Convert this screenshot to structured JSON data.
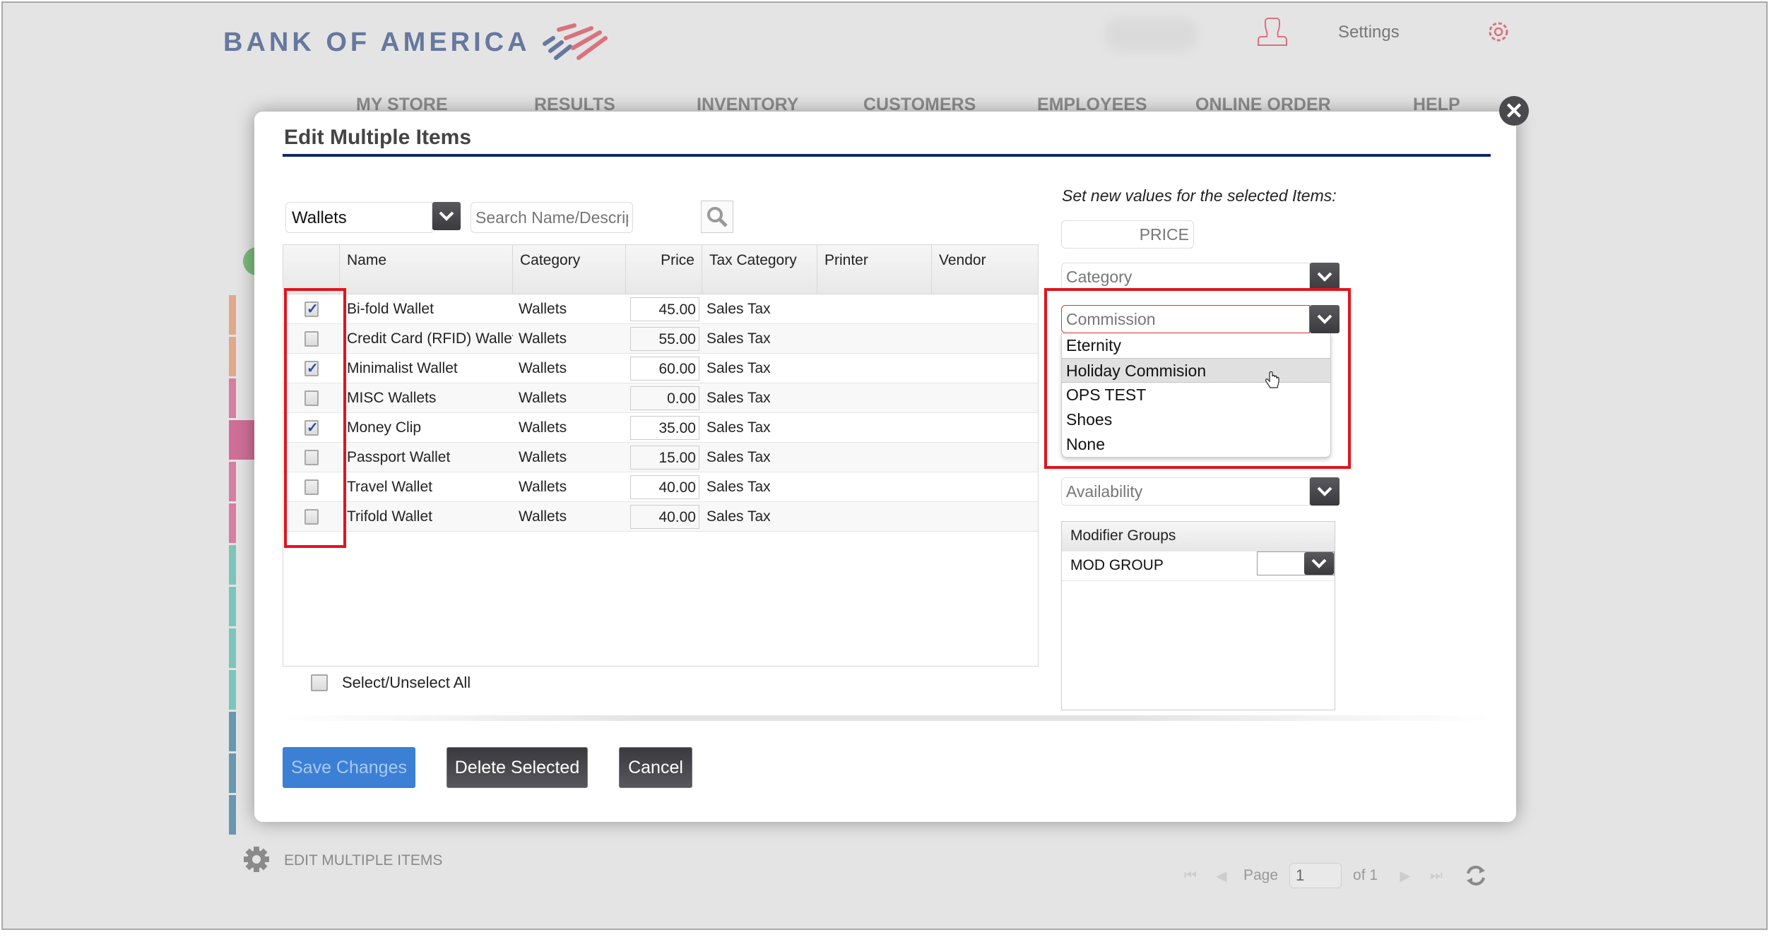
{
  "header": {
    "brand": "BANK OF AMERICA",
    "settings_label": "Settings",
    "brand_colors": {
      "blue": "#66789e",
      "red": "#d9727d"
    }
  },
  "nav": {
    "items": [
      "MY STORE",
      "RESULTS",
      "INVENTORY",
      "CUSTOMERS",
      "EMPLOYEES",
      "ONLINE ORDER",
      "HELP"
    ]
  },
  "background": {
    "stripe_colors": [
      "#e0a98c",
      "#e0a98c",
      "#d77ea2",
      "#cf6f97",
      "#d77ea2",
      "#d77ea2",
      "#7dc4bc",
      "#7dc4bc",
      "#7dc4bc",
      "#7dc4bc",
      "#6898b0",
      "#6898b0",
      "#6898b0"
    ],
    "footer_label": "EDIT MULTIPLE ITEMS",
    "pager": {
      "page_label": "Page",
      "page_value": "1",
      "of_label": "of 1"
    }
  },
  "modal": {
    "title": "Edit Multiple Items",
    "filter": {
      "selected": "Wallets",
      "search_placeholder": "Search Name/Description"
    },
    "table": {
      "columns": [
        "",
        "Name",
        "Category",
        "Price",
        "Tax Category",
        "Printer",
        "Vendor"
      ],
      "rows": [
        {
          "checked": true,
          "name": "Bi-fold Wallet",
          "category": "Wallets",
          "price": "45.00",
          "tax": "Sales Tax",
          "printer": "",
          "vendor": ""
        },
        {
          "checked": false,
          "name": "Credit Card (RFID) Wallet",
          "category": "Wallets",
          "price": "55.00",
          "tax": "Sales Tax",
          "printer": "",
          "vendor": ""
        },
        {
          "checked": true,
          "name": "Minimalist Wallet",
          "category": "Wallets",
          "price": "60.00",
          "tax": "Sales Tax",
          "printer": "",
          "vendor": ""
        },
        {
          "checked": false,
          "name": "MISC Wallets",
          "category": "Wallets",
          "price": "0.00",
          "tax": "Sales Tax",
          "printer": "",
          "vendor": ""
        },
        {
          "checked": true,
          "name": "Money Clip",
          "category": "Wallets",
          "price": "35.00",
          "tax": "Sales Tax",
          "printer": "",
          "vendor": ""
        },
        {
          "checked": false,
          "name": "Passport Wallet",
          "category": "Wallets",
          "price": "15.00",
          "tax": "Sales Tax",
          "printer": "",
          "vendor": ""
        },
        {
          "checked": false,
          "name": "Travel Wallet",
          "category": "Wallets",
          "price": "40.00",
          "tax": "Sales Tax",
          "printer": "",
          "vendor": ""
        },
        {
          "checked": false,
          "name": "Trifold Wallet",
          "category": "Wallets",
          "price": "40.00",
          "tax": "Sales Tax",
          "printer": "",
          "vendor": ""
        }
      ]
    },
    "select_all_label": "Select/Unselect All",
    "buttons": {
      "save": "Save Changes",
      "delete": "Delete Selected",
      "cancel": "Cancel"
    },
    "right_panel": {
      "instruction": "Set new values for the selected Items:",
      "price_placeholder": "PRICE",
      "category_placeholder": "Category",
      "commission_placeholder": "Commission",
      "commission_options": [
        "Eternity",
        "Holiday Commision",
        "OPS TEST",
        "Shoes",
        "None"
      ],
      "hovered_option": "Holiday Commision",
      "availability_placeholder": "Availability",
      "modifier_groups": {
        "header": "Modifier Groups",
        "rows": [
          {
            "name": "MOD GROUP",
            "value": ""
          }
        ]
      }
    },
    "highlight_color": "#e0141c"
  }
}
